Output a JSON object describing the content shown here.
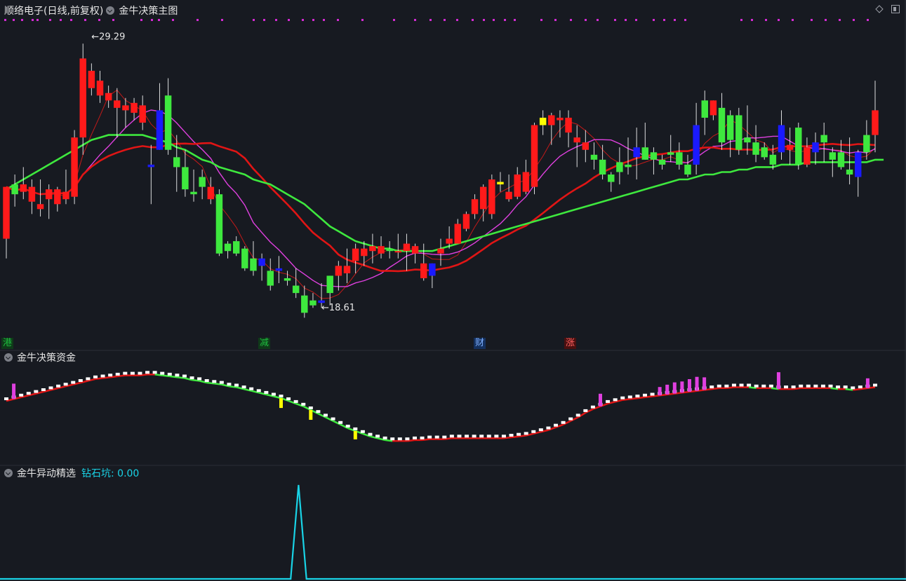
{
  "header": {
    "stock_name": "顺络电子(日线,前复权)",
    "main_indicator": "金牛决策主图"
  },
  "panel2": {
    "title": "金牛决策资金"
  },
  "panel3": {
    "title": "金牛异动精选",
    "value_label": "钻石坑: 0.00"
  },
  "annotations": {
    "high": "29.29",
    "low": "18.61"
  },
  "event_tags": [
    {
      "text": "港",
      "color": "#1fbf3f"
    },
    {
      "text": "减",
      "color": "#1fbf3f"
    },
    {
      "text": "财",
      "color": "#3f7fe0"
    },
    {
      "text": "涨",
      "color": "#e02020"
    }
  ],
  "colors": {
    "up": "#ff1a1a",
    "down": "#3ee83e",
    "blue": "#1a1aff",
    "yellow": "#ffff00",
    "ma_magenta": "#e040e0",
    "ma_red": "#e01515",
    "ma_green": "#3ee83e",
    "cyan": "#19d3e6",
    "bg": "#171a21"
  },
  "chart_data": [
    {
      "type": "candlestick",
      "title": "金牛决策主图",
      "ylim": [
        17.5,
        30.5
      ],
      "candles": [
        {
          "o": 21.4,
          "h": 23.2,
          "l": 20.6,
          "c": 23.5,
          "k": "up"
        },
        {
          "o": 23.6,
          "h": 24.0,
          "l": 22.7,
          "c": 23.2,
          "k": "down"
        },
        {
          "o": 23.3,
          "h": 24.3,
          "l": 23.0,
          "c": 23.6,
          "k": "up"
        },
        {
          "o": 23.5,
          "h": 23.8,
          "l": 22.4,
          "c": 22.9,
          "k": "up"
        },
        {
          "o": 22.6,
          "h": 23.8,
          "l": 22.3,
          "c": 22.8,
          "k": "up"
        },
        {
          "o": 23.0,
          "h": 23.6,
          "l": 22.2,
          "c": 23.4,
          "k": "up"
        },
        {
          "o": 22.8,
          "h": 23.5,
          "l": 22.5,
          "c": 23.4,
          "k": "up"
        },
        {
          "o": 23.3,
          "h": 24.2,
          "l": 22.8,
          "c": 23.0,
          "k": "up"
        },
        {
          "o": 23.1,
          "h": 25.8,
          "l": 22.8,
          "c": 25.5,
          "k": "up"
        },
        {
          "o": 25.5,
          "h": 29.3,
          "l": 24.8,
          "c": 28.7,
          "k": "up"
        },
        {
          "o": 28.2,
          "h": 28.5,
          "l": 27.2,
          "c": 27.5,
          "k": "up"
        },
        {
          "o": 27.8,
          "h": 28.2,
          "l": 26.9,
          "c": 27.2,
          "k": "up"
        },
        {
          "o": 27.3,
          "h": 27.6,
          "l": 26.7,
          "c": 27.0,
          "k": "up"
        },
        {
          "o": 27.0,
          "h": 27.5,
          "l": 25.5,
          "c": 26.7,
          "k": "up"
        },
        {
          "o": 26.8,
          "h": 27.1,
          "l": 25.9,
          "c": 26.6,
          "k": "up"
        },
        {
          "o": 26.9,
          "h": 27.1,
          "l": 26.2,
          "c": 26.5,
          "k": "up"
        },
        {
          "o": 26.8,
          "h": 27.2,
          "l": 25.8,
          "c": 26.1,
          "k": "up"
        },
        {
          "o": 24.4,
          "h": 25.2,
          "l": 22.8,
          "c": 24.3,
          "k": "blue"
        },
        {
          "o": 26.6,
          "h": 27.7,
          "l": 25.4,
          "c": 25.0,
          "k": "blue"
        },
        {
          "o": 25.0,
          "h": 27.9,
          "l": 24.8,
          "c": 27.2,
          "k": "down"
        },
        {
          "o": 24.7,
          "h": 25.6,
          "l": 23.3,
          "c": 24.3,
          "k": "down"
        },
        {
          "o": 24.3,
          "h": 25.0,
          "l": 23.1,
          "c": 23.4,
          "k": "down"
        },
        {
          "o": 23.3,
          "h": 24.2,
          "l": 22.9,
          "c": 23.2,
          "k": "down"
        },
        {
          "o": 23.9,
          "h": 24.2,
          "l": 23.0,
          "c": 23.5,
          "k": "down"
        },
        {
          "o": 23.5,
          "h": 23.9,
          "l": 22.8,
          "c": 23.0,
          "k": "up"
        },
        {
          "o": 23.2,
          "h": 23.4,
          "l": 20.7,
          "c": 20.8,
          "k": "down"
        },
        {
          "o": 20.9,
          "h": 21.3,
          "l": 20.6,
          "c": 21.2,
          "k": "down"
        },
        {
          "o": 21.3,
          "h": 21.5,
          "l": 20.7,
          "c": 20.8,
          "k": "down"
        },
        {
          "o": 21.0,
          "h": 21.1,
          "l": 20.1,
          "c": 20.2,
          "k": "down"
        },
        {
          "o": 20.6,
          "h": 21.3,
          "l": 19.9,
          "c": 20.1,
          "k": "down"
        },
        {
          "o": 20.6,
          "h": 20.8,
          "l": 19.7,
          "c": 20.3,
          "k": "blue"
        },
        {
          "o": 20.1,
          "h": 20.6,
          "l": 19.3,
          "c": 19.5,
          "k": "down"
        },
        {
          "o": 20.2,
          "h": 20.7,
          "l": 19.6,
          "c": 20.1,
          "k": "blue"
        },
        {
          "o": 19.7,
          "h": 20.1,
          "l": 19.5,
          "c": 19.8,
          "k": "down"
        },
        {
          "o": 19.5,
          "h": 20.2,
          "l": 19.0,
          "c": 19.2,
          "k": "down"
        },
        {
          "o": 19.1,
          "h": 19.5,
          "l": 18.2,
          "c": 18.4,
          "k": "down"
        },
        {
          "o": 18.9,
          "h": 19.2,
          "l": 18.6,
          "c": 18.7,
          "k": "down"
        },
        {
          "o": 18.9,
          "h": 19.6,
          "l": 18.6,
          "c": 18.8,
          "k": "blue"
        },
        {
          "o": 19.2,
          "h": 19.9,
          "l": 18.7,
          "c": 19.9,
          "k": "down"
        },
        {
          "o": 20.3,
          "h": 20.5,
          "l": 19.3,
          "c": 19.9,
          "k": "up"
        },
        {
          "o": 20.0,
          "h": 21.0,
          "l": 19.6,
          "c": 20.3,
          "k": "up"
        },
        {
          "o": 20.5,
          "h": 21.2,
          "l": 20.0,
          "c": 21.0,
          "k": "up"
        },
        {
          "o": 20.7,
          "h": 21.3,
          "l": 20.3,
          "c": 21.0,
          "k": "up"
        },
        {
          "o": 20.9,
          "h": 21.6,
          "l": 20.4,
          "c": 21.1,
          "k": "up"
        },
        {
          "o": 21.1,
          "h": 21.5,
          "l": 20.6,
          "c": 20.8,
          "k": "up"
        },
        {
          "o": 21.0,
          "h": 21.3,
          "l": 20.6,
          "c": 20.9,
          "k": "down"
        },
        {
          "o": 20.9,
          "h": 21.6,
          "l": 20.6,
          "c": 20.9,
          "k": "up"
        },
        {
          "o": 20.9,
          "h": 21.6,
          "l": 20.1,
          "c": 21.2,
          "k": "up"
        },
        {
          "o": 20.8,
          "h": 21.2,
          "l": 20.4,
          "c": 21.1,
          "k": "up"
        },
        {
          "o": 20.4,
          "h": 21.2,
          "l": 19.7,
          "c": 19.8,
          "k": "up"
        },
        {
          "o": 20.4,
          "h": 20.4,
          "l": 19.4,
          "c": 19.9,
          "k": "blue"
        },
        {
          "o": 21.0,
          "h": 21.4,
          "l": 20.3,
          "c": 20.8,
          "k": "up"
        },
        {
          "o": 21.4,
          "h": 21.9,
          "l": 21.0,
          "c": 21.2,
          "k": "up"
        },
        {
          "o": 21.2,
          "h": 22.2,
          "l": 21.2,
          "c": 22.0,
          "k": "up"
        },
        {
          "o": 21.8,
          "h": 22.5,
          "l": 21.7,
          "c": 22.4,
          "k": "up"
        },
        {
          "o": 22.4,
          "h": 23.2,
          "l": 22.2,
          "c": 23.0,
          "k": "up"
        },
        {
          "o": 22.6,
          "h": 23.6,
          "l": 22.1,
          "c": 23.5,
          "k": "up"
        },
        {
          "o": 22.4,
          "h": 24.0,
          "l": 22.2,
          "c": 23.8,
          "k": "up"
        },
        {
          "o": 23.6,
          "h": 24.1,
          "l": 23.3,
          "c": 23.7,
          "k": "yellow"
        },
        {
          "o": 23.0,
          "h": 24.0,
          "l": 22.9,
          "c": 23.3,
          "k": "up"
        },
        {
          "o": 23.1,
          "h": 24.3,
          "l": 23.0,
          "c": 24.0,
          "k": "up"
        },
        {
          "o": 23.3,
          "h": 24.6,
          "l": 23.2,
          "c": 24.1,
          "k": "up"
        },
        {
          "o": 23.5,
          "h": 26.1,
          "l": 23.2,
          "c": 26.0,
          "k": "up"
        },
        {
          "o": 26.0,
          "h": 26.6,
          "l": 25.6,
          "c": 26.3,
          "k": "yellow"
        },
        {
          "o": 26.0,
          "h": 26.5,
          "l": 25.2,
          "c": 26.4,
          "k": "up"
        },
        {
          "o": 26.2,
          "h": 26.6,
          "l": 25.5,
          "c": 26.3,
          "k": "up"
        },
        {
          "o": 26.3,
          "h": 26.6,
          "l": 25.1,
          "c": 25.7,
          "k": "up"
        },
        {
          "o": 25.3,
          "h": 26.0,
          "l": 24.3,
          "c": 25.5,
          "k": "up"
        },
        {
          "o": 25.3,
          "h": 25.8,
          "l": 24.5,
          "c": 25.0,
          "k": "up"
        },
        {
          "o": 24.6,
          "h": 25.3,
          "l": 24.2,
          "c": 24.8,
          "k": "down"
        },
        {
          "o": 24.6,
          "h": 25.2,
          "l": 23.8,
          "c": 24.0,
          "k": "down"
        },
        {
          "o": 23.7,
          "h": 24.1,
          "l": 23.3,
          "c": 24.0,
          "k": "down"
        },
        {
          "o": 24.1,
          "h": 25.1,
          "l": 23.6,
          "c": 24.5,
          "k": "down"
        },
        {
          "o": 24.4,
          "h": 25.5,
          "l": 24.0,
          "c": 24.3,
          "k": "down"
        },
        {
          "o": 24.7,
          "h": 25.9,
          "l": 23.8,
          "c": 25.1,
          "k": "blue"
        },
        {
          "o": 25.1,
          "h": 26.1,
          "l": 24.6,
          "c": 24.6,
          "k": "down"
        },
        {
          "o": 24.9,
          "h": 25.1,
          "l": 24.0,
          "c": 24.6,
          "k": "down"
        },
        {
          "o": 24.6,
          "h": 24.8,
          "l": 24.2,
          "c": 24.4,
          "k": "down"
        },
        {
          "o": 24.8,
          "h": 25.6,
          "l": 24.5,
          "c": 24.9,
          "k": "down"
        },
        {
          "o": 24.9,
          "h": 25.3,
          "l": 24.2,
          "c": 24.4,
          "k": "down"
        },
        {
          "o": 24.4,
          "h": 24.8,
          "l": 23.9,
          "c": 24.0,
          "k": "down"
        },
        {
          "o": 24.4,
          "h": 26.9,
          "l": 24.0,
          "c": 26.0,
          "k": "blue"
        },
        {
          "o": 26.3,
          "h": 27.4,
          "l": 25.6,
          "c": 27.0,
          "k": "down"
        },
        {
          "o": 27.0,
          "h": 26.8,
          "l": 26.2,
          "c": 26.4,
          "k": "up"
        },
        {
          "o": 26.7,
          "h": 27.3,
          "l": 25.0,
          "c": 25.3,
          "k": "down"
        },
        {
          "o": 25.4,
          "h": 26.6,
          "l": 24.7,
          "c": 26.4,
          "k": "down"
        },
        {
          "o": 26.4,
          "h": 26.7,
          "l": 24.8,
          "c": 25.0,
          "k": "down"
        },
        {
          "o": 25.3,
          "h": 26.8,
          "l": 24.8,
          "c": 25.5,
          "k": "down"
        },
        {
          "o": 25.3,
          "h": 26.0,
          "l": 24.5,
          "c": 24.8,
          "k": "down"
        },
        {
          "o": 25.1,
          "h": 25.3,
          "l": 24.6,
          "c": 24.7,
          "k": "down"
        },
        {
          "o": 24.8,
          "h": 25.2,
          "l": 24.2,
          "c": 24.4,
          "k": "down"
        },
        {
          "o": 24.9,
          "h": 26.6,
          "l": 24.6,
          "c": 26.0,
          "k": "blue"
        },
        {
          "o": 25.2,
          "h": 25.9,
          "l": 24.4,
          "c": 25.0,
          "k": "up"
        },
        {
          "o": 25.9,
          "h": 26.1,
          "l": 24.2,
          "c": 24.4,
          "k": "down"
        },
        {
          "o": 24.4,
          "h": 25.5,
          "l": 24.3,
          "c": 25.1,
          "k": "up"
        },
        {
          "o": 24.9,
          "h": 25.7,
          "l": 24.4,
          "c": 25.3,
          "k": "blue"
        },
        {
          "o": 25.6,
          "h": 26.1,
          "l": 24.5,
          "c": 25.3,
          "k": "down"
        },
        {
          "o": 24.6,
          "h": 25.1,
          "l": 23.9,
          "c": 24.9,
          "k": "down"
        },
        {
          "o": 24.9,
          "h": 25.4,
          "l": 24.2,
          "c": 24.3,
          "k": "down"
        },
        {
          "o": 24.2,
          "h": 25.5,
          "l": 23.6,
          "c": 24.0,
          "k": "down"
        },
        {
          "o": 23.9,
          "h": 25.0,
          "l": 23.1,
          "c": 24.9,
          "k": "blue"
        },
        {
          "o": 24.9,
          "h": 26.2,
          "l": 24.6,
          "c": 25.6,
          "k": "down"
        },
        {
          "o": 25.6,
          "h": 27.8,
          "l": 24.9,
          "c": 26.6,
          "k": "up"
        }
      ],
      "moving_averages": [
        {
          "color": "ma_green",
          "values": [
            23.4,
            23.6,
            23.8,
            24.0,
            24.2,
            24.4,
            24.6,
            24.8,
            25.0,
            25.2,
            25.4,
            25.5,
            25.6,
            25.6,
            25.6,
            25.6,
            25.6,
            25.5,
            25.4,
            25.3,
            25.1,
            25.0,
            24.8,
            24.6,
            24.5,
            24.3,
            24.2,
            24.1,
            24.0,
            23.8,
            23.7,
            23.6,
            23.4,
            23.2,
            23.0,
            22.8,
            22.5,
            22.2,
            21.9,
            21.7,
            21.5,
            21.3,
            21.2,
            21.1,
            21.0,
            21.0,
            20.9,
            20.9,
            20.9,
            20.9,
            20.9,
            21.0,
            21.1,
            21.2,
            21.3,
            21.4,
            21.5,
            21.6,
            21.7,
            21.8,
            21.9,
            22.0,
            22.1,
            22.2,
            22.3,
            22.4,
            22.5,
            22.6,
            22.7,
            22.8,
            22.9,
            23.0,
            23.1,
            23.2,
            23.3,
            23.4,
            23.5,
            23.6,
            23.7,
            23.8,
            23.8,
            23.9,
            24.0,
            24.0,
            24.1,
            24.1,
            24.2,
            24.2,
            24.3,
            24.3,
            24.3,
            24.4,
            24.4,
            24.4,
            24.5,
            24.5,
            24.5,
            24.5,
            24.5,
            24.5,
            24.5,
            24.5,
            24.6,
            24.6
          ]
        }
      ],
      "annotations": [
        {
          "text": "29.29",
          "x_index": 9,
          "y": 29.29
        },
        {
          "text": "18.61",
          "x_index": 36,
          "y": 18.61
        }
      ],
      "event_tags": [
        "港",
        "减",
        "财",
        "涨"
      ]
    },
    {
      "type": "line",
      "title": "金牛决策资金",
      "ylim": [
        0,
        100
      ],
      "values": [
        60,
        62,
        64,
        66,
        68,
        70,
        72,
        74,
        76,
        78,
        80,
        82,
        84,
        85,
        86,
        87,
        88,
        88,
        88,
        89,
        89,
        88,
        87,
        86,
        85,
        83,
        82,
        80,
        79,
        78,
        76,
        75,
        73,
        71,
        69,
        67,
        65,
        63,
        60,
        57,
        54,
        50,
        46,
        42,
        38,
        34,
        30,
        27,
        24,
        21,
        19,
        17,
        16,
        16,
        16,
        17,
        17,
        18,
        18,
        18,
        19,
        19,
        19,
        19,
        19,
        19,
        19,
        19,
        20,
        21,
        22,
        24,
        26,
        28,
        31,
        34,
        38,
        42,
        47,
        51,
        54,
        57,
        59,
        61,
        62,
        63,
        64,
        65,
        66,
        67,
        68,
        69,
        70,
        71,
        72,
        73,
        74,
        74,
        75,
        75,
        75,
        74,
        74,
        74,
        73,
        73,
        73,
        74,
        74,
        74,
        74,
        74,
        73,
        73,
        72,
        73,
        74,
        75
      ]
    },
    {
      "type": "line",
      "title": "金牛异动精选",
      "series": [
        {
          "name": "钻石坑",
          "values": [
            0,
            0,
            0,
            0,
            0,
            0,
            0,
            0,
            0,
            0,
            0,
            0,
            0,
            0,
            0,
            0,
            0,
            0,
            0,
            0,
            0,
            0,
            0,
            0,
            0,
            0,
            0,
            0,
            0,
            0,
            0,
            0,
            0,
            0,
            0,
            0,
            0,
            1,
            0,
            0,
            0,
            0,
            0,
            0,
            0,
            0,
            0,
            0,
            0,
            0,
            0,
            0,
            0,
            0,
            0,
            0,
            0,
            0,
            0,
            0,
            0,
            0,
            0,
            0,
            0,
            0,
            0,
            0,
            0,
            0,
            0,
            0,
            0,
            0,
            0,
            0,
            0,
            0,
            0,
            0,
            0,
            0,
            0,
            0,
            0,
            0,
            0,
            0,
            0,
            0,
            0,
            0,
            0,
            0,
            0,
            0,
            0,
            0,
            0,
            0,
            0,
            0,
            0,
            0,
            0,
            0,
            0,
            0,
            0,
            0,
            0
          ]
        }
      ],
      "ylim": [
        0,
        1
      ]
    }
  ]
}
